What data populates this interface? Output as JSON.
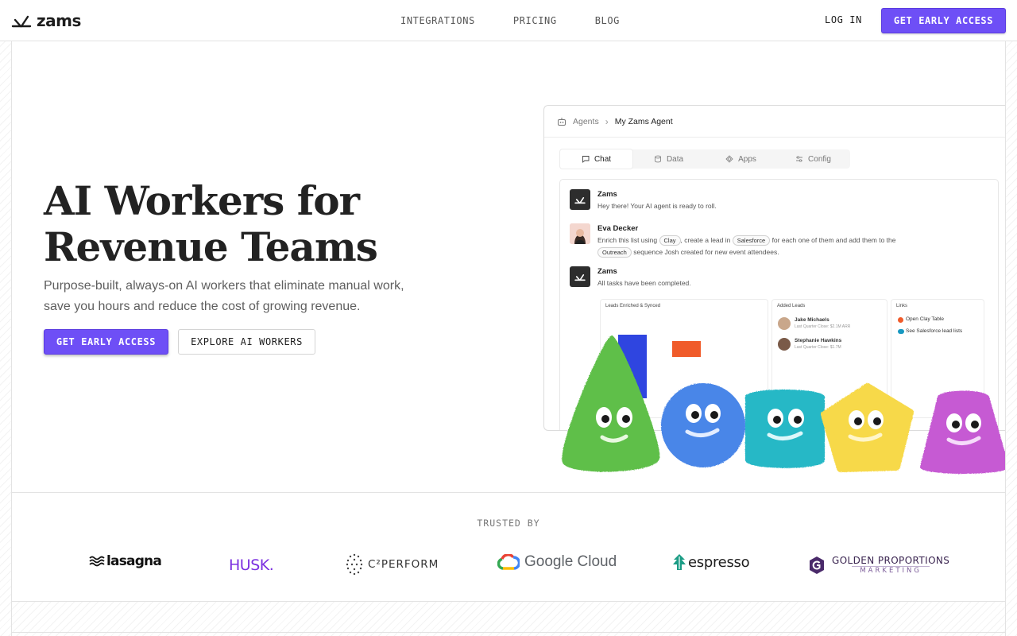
{
  "header": {
    "logo": "zams",
    "nav": [
      "INTEGRATIONS",
      "PRICING",
      "BLOG"
    ],
    "login": "LOG IN",
    "cta": "GET EARLY ACCESS"
  },
  "hero": {
    "title_line1": "AI Workers for",
    "title_line2": "Revenue Teams",
    "subtitle_line1": "Purpose-built, always-on AI workers that eliminate manual work,",
    "subtitle_line2": "save you hours and reduce the cost of growing revenue.",
    "primary_cta": "GET EARLY ACCESS",
    "secondary_cta": "EXPLORE AI WORKERS"
  },
  "app": {
    "breadcrumb": [
      "Agents",
      "My Zams Agent"
    ],
    "tabs": [
      "Chat",
      "Data",
      "Apps",
      "Config"
    ],
    "messages": [
      {
        "name": "Zams",
        "text": "Hey there! Your AI agent is ready to roll."
      },
      {
        "name": "Eva Decker",
        "text_a": "Enrich this list using",
        "chip1": "Clay",
        "text_b": ", create a lead in",
        "chip2": "Salesforce",
        "text_c": "for each one of them and add them to the",
        "chip3": "Outreach",
        "text_d": "sequence Josh created for new event attendees."
      },
      {
        "name": "Zams",
        "text": "All tasks have been completed."
      }
    ],
    "panels": {
      "leads_title": "Leads Enriched & Synced",
      "added_title": "Added Leads",
      "added": [
        {
          "name": "Jake Michaels",
          "sub": "Last Quarter Close: $2.1M ARR"
        },
        {
          "name": "Stephanie Hawkins",
          "sub": "Last Quarter Close: $1.7M"
        }
      ],
      "links_title": "Links",
      "links": [
        "Open Clay Table",
        "See Salesforce lead lists"
      ]
    }
  },
  "trusted": {
    "label": "TRUSTED BY",
    "brands": [
      "lasagna",
      "HUSK.",
      "C²PERFORM",
      "Google Cloud",
      "espresso",
      "GOLDEN PROPORTIONS",
      "MARKETING"
    ]
  },
  "colors": {
    "accent": "#6e4ff6",
    "text": "#222222",
    "muted": "#5f5f5f"
  }
}
